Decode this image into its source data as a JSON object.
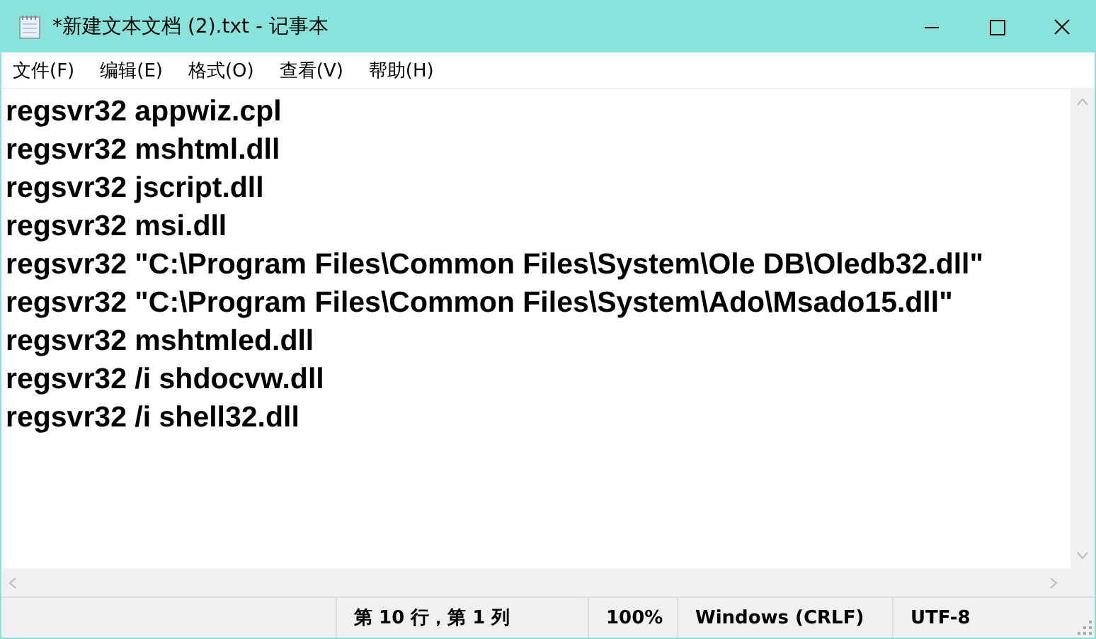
{
  "window": {
    "title": "*新建文本文档 (2).txt - 记事本"
  },
  "menu": [
    "文件(F)",
    "编辑(E)",
    "格式(O)",
    "查看(V)",
    "帮助(H)"
  ],
  "lines": [
    "regsvr32 appwiz.cpl",
    "regsvr32 mshtml.dll",
    "regsvr32 jscript.dll",
    "regsvr32 msi.dll",
    "regsvr32 \"C:\\Program Files\\Common Files\\System\\Ole DB\\Oledb32.dll\"",
    "regsvr32 \"C:\\Program Files\\Common Files\\System\\Ado\\Msado15.dll\"",
    "regsvr32 mshtmled.dll",
    "regsvr32 /i shdocvw.dll",
    "regsvr32 /i shell32.dll"
  ],
  "status_bar": [
    "第 10 行，第 1 列",
    "100%",
    "Windows (CRLF)",
    "UTF-8"
  ]
}
